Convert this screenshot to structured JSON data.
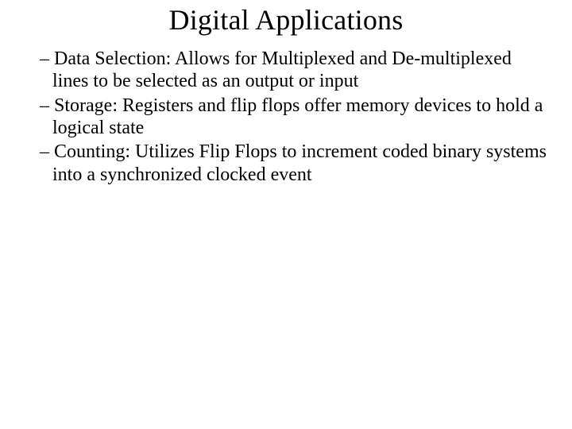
{
  "title": "Digital Applications",
  "dash": "– ",
  "bullets": [
    "Data Selection: Allows for Multiplexed and De-multiplexed lines to be selected as an output or input",
    "Storage: Registers and flip flops offer memory devices to hold a logical state",
    "Counting: Utilizes Flip Flops to increment coded binary systems into a synchronized clocked event"
  ]
}
